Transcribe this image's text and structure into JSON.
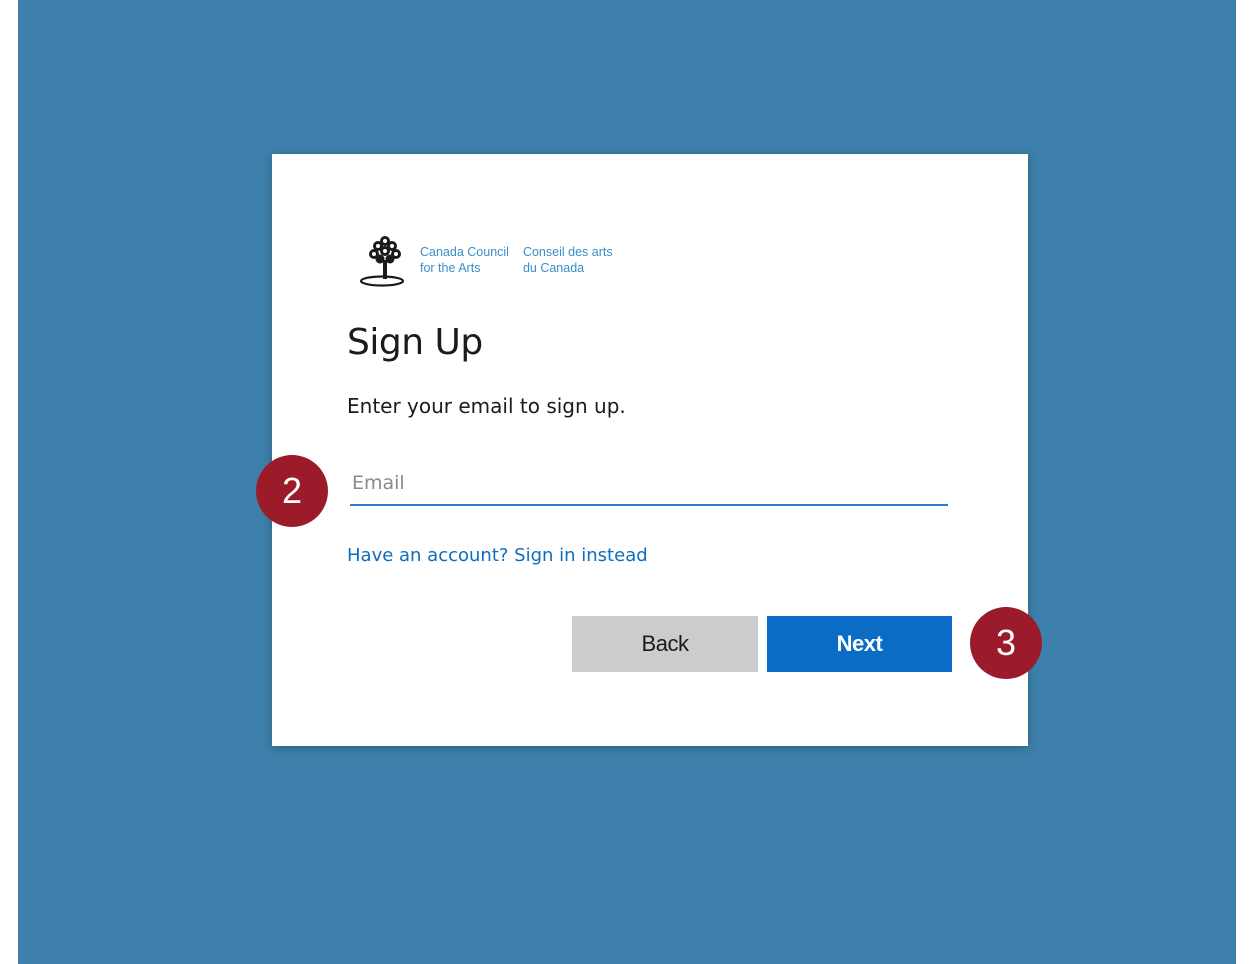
{
  "logo": {
    "en_line1": "Canada Council",
    "en_line2": "for the Arts",
    "fr_line1": "Conseil des arts",
    "fr_line2": "du Canada",
    "icon": "tree-icon"
  },
  "form": {
    "title": "Sign Up",
    "subtitle": "Enter your email to sign up.",
    "email_placeholder": "Email",
    "email_value": "",
    "signin_link": "Have an account? Sign in instead"
  },
  "buttons": {
    "back_label": "Back",
    "next_label": "Next"
  },
  "markers": {
    "email_step": "2",
    "next_step": "3"
  },
  "colors": {
    "background": "#3d80ab",
    "primary": "#0b6cc5",
    "link": "#0f6cbd",
    "marker": "#9b1b2a"
  }
}
